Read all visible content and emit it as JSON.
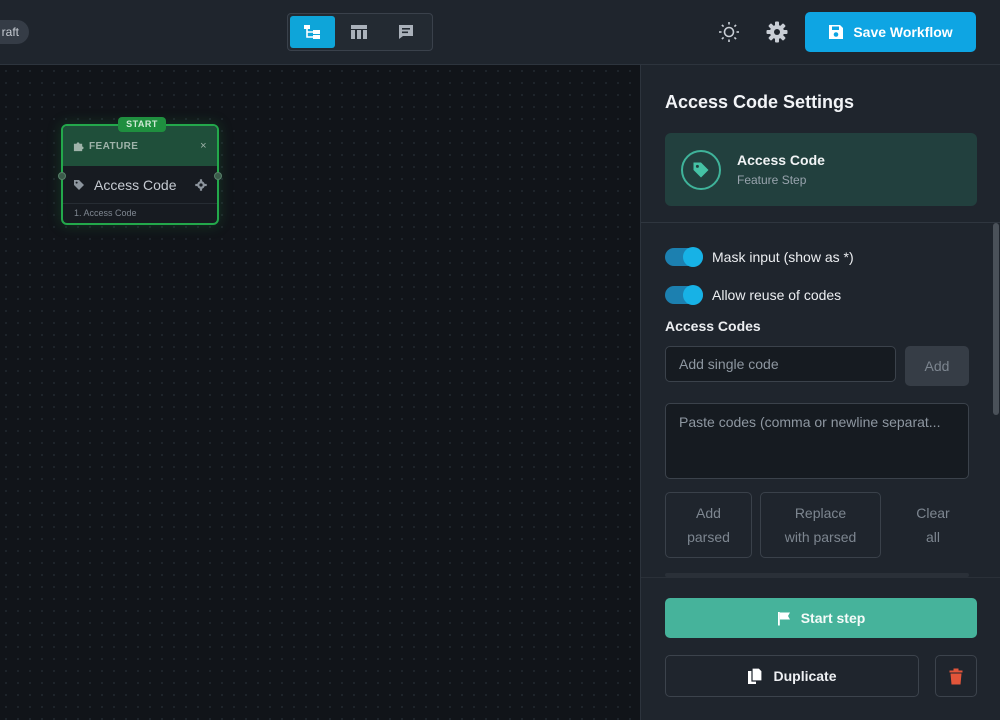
{
  "topbar": {
    "status_label": "raft",
    "views": [
      {
        "icon": "tree-icon",
        "active": true
      },
      {
        "icon": "table-icon",
        "active": false
      },
      {
        "icon": "chat-icon",
        "active": false
      }
    ],
    "save_label": "Save Workflow"
  },
  "canvas": {
    "node": {
      "badge": "START",
      "type_label": "FEATURE",
      "close_glyph": "×",
      "title": "Access Code",
      "footer": "1.  Access Code"
    }
  },
  "panel": {
    "title": "Access Code Settings",
    "step": {
      "name": "Access Code",
      "subtitle": "Feature Step"
    },
    "toggles": [
      {
        "label": "Mask input (show as *)",
        "on": true
      },
      {
        "label": "Allow reuse of codes",
        "on": true
      }
    ],
    "codes_label": "Access Codes",
    "single_placeholder": "Add single code",
    "add_label": "Add",
    "paste_placeholder": "Paste codes (comma or newline separat...",
    "add_parsed": [
      "Add",
      "parsed"
    ],
    "replace_parsed": [
      "Replace",
      "with parsed"
    ],
    "clear_all": [
      "Clear",
      "all"
    ],
    "start_step_label": "Start step",
    "duplicate_label": "Duplicate"
  },
  "colors": {
    "accent": "#0ea5e3",
    "start_green": "#46b39b",
    "node_border": "#23a84b",
    "delete_red": "#e2553a"
  }
}
